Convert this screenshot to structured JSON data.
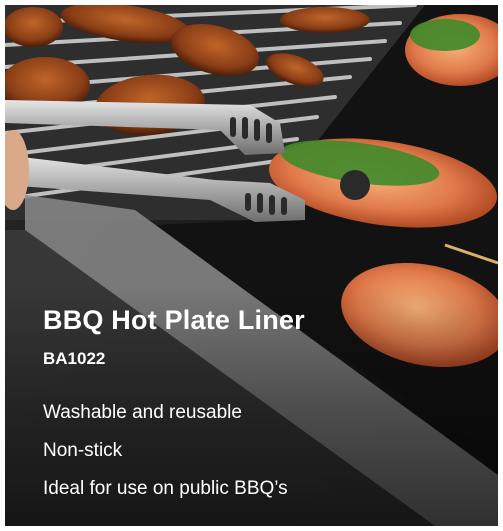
{
  "product": {
    "title": "BBQ Hot Plate Liner",
    "code": "BA1022"
  },
  "features": [
    "Washable and reusable",
    "Non-stick",
    "Ideal for use on public BBQ’s"
  ],
  "colors": {
    "text": "#ffffff",
    "hotplate": "#1a1a1a",
    "grill_rods": "#c9c9c9",
    "tongs": "#b8b8b8",
    "herbs": "#3f8a2a",
    "seafood": "#e07a4a"
  }
}
